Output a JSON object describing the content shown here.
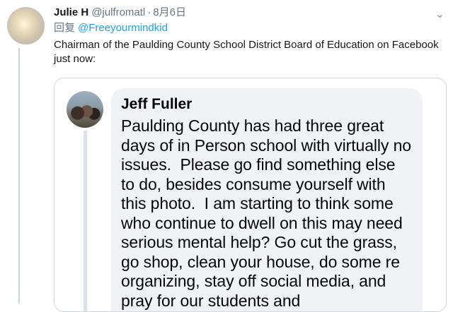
{
  "tweet": {
    "author_name": "Julie H",
    "author_handle": "@julfromatl",
    "separator": "·",
    "date": "8月6日",
    "reply_prefix": "回复",
    "reply_to": "@Freeyourmindkid",
    "text": "Chairman of the Paulding County School District Board of Education on Facebook just now:",
    "more_icon": "chevron-down-icon"
  },
  "facebook_post": {
    "author_name": "Jeff Fuller",
    "text": "Paulding County has had three great days of in Person school with virtually no issues.  Please go find something else to do, besides consume yourself with this photo.  I am starting to think some who continue to dwell on this may need serious mental help? Go cut the grass,  go shop, clean your house, do some re organizing, stay off social media, and pray for our students and"
  },
  "colors": {
    "link": "#1da1f2",
    "secondary_text": "#657786",
    "bubble_bg": "#f0f2f5"
  }
}
